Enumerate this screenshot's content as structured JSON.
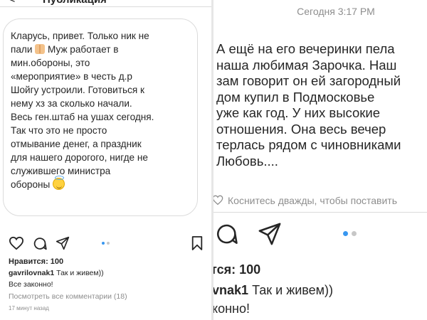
{
  "left": {
    "header": {
      "back_glyph": "<",
      "title": "Публикация"
    },
    "message_lines": [
      "Кларусь, привет. Только ник не",
      "пали",
      "Муж работает в",
      "мин.обороны, это",
      "«мероприятие» в честь д.р",
      "Шойгу устроили. Готовиться к",
      "нему хз за сколько начали.",
      "Весь ген.штаб на ушах сегодня.",
      "Так что это не просто",
      "отмывание денег, а праздник",
      "для нашего дорогого, нигде не",
      "служившего министра",
      "обороны"
    ],
    "likes": "Нравится: 100",
    "comment": {
      "user": "gavrilovnak1",
      "text": "Так и живем))"
    },
    "comment_line2": "Все законно!",
    "view_all": "Посмотреть все комментарии (18)",
    "time_ago": "17 минут назад",
    "icons": [
      "heart-icon",
      "comment-icon",
      "share-icon",
      "bookmark-icon"
    ]
  },
  "right": {
    "timestamp": "Сегодня 3:17 PM",
    "message_lines": [
      "А ещё на его вечеринки пела",
      "наша любимая Зарочка. Наш",
      "зам говорит он ей загородный",
      "дом купил в Подмосковье",
      "уже как год. У них высокие",
      "отношения. Она весь вечер",
      "терлась рядом с чиновниками",
      "Любовь...."
    ],
    "double_tap_hint": "Коснитесь дважды, чтобы поставить",
    "likes": "тся: 100",
    "comment": {
      "user": "vnak1",
      "text": "Так и живем))"
    },
    "comment_line2": "конно!",
    "icons": [
      "comment-icon",
      "share-icon"
    ]
  },
  "colors": {
    "accent_dot": "#3897f0",
    "muted_text": "#8e8e8e",
    "text": "#262626",
    "border": "#dbdbdb"
  }
}
